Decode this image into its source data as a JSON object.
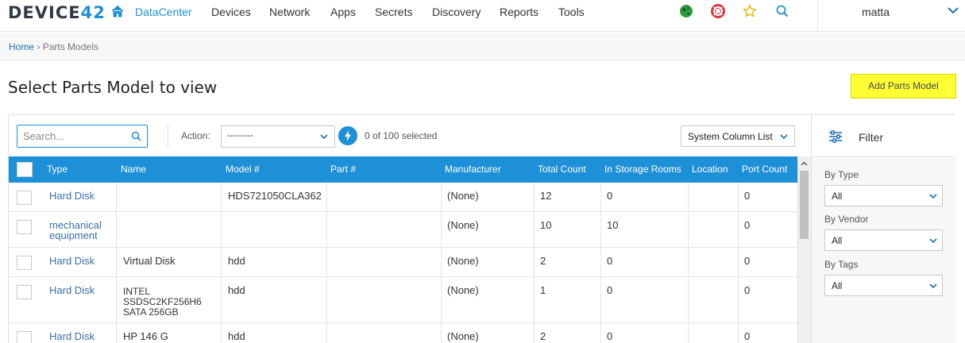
{
  "nav": {
    "logo_prefix": "DEVICE",
    "logo_suffix": "42",
    "items": [
      "DataCenter",
      "Devices",
      "Network",
      "Apps",
      "Secrets",
      "Discovery",
      "Reports",
      "Tools"
    ],
    "user": "matta",
    "icons": [
      "home-icon",
      "globe-icon",
      "help-lifebuoy-icon",
      "star-icon",
      "search-icon",
      "chevron-down-icon"
    ],
    "accent": "#1e90d8"
  },
  "breadcrumb": {
    "home": "Home",
    "separator": "›",
    "current": "Parts Models"
  },
  "page": {
    "title": "Select Parts Model to view",
    "add_button": "Add Parts Model",
    "add_button_color": "#ffff33"
  },
  "toolbar": {
    "search_placeholder": "Search...",
    "action_label": "Action:",
    "action_value": "---------",
    "selected_count": "0 of 100 selected",
    "column_list": "System Column List"
  },
  "table": {
    "header_color": "#1e90d8",
    "columns": [
      "Type",
      "Name",
      "Model #",
      "Part #",
      "Manufacturer",
      "Total Count",
      "In Storage Rooms",
      "Location",
      "Port Count"
    ],
    "rows": [
      {
        "type": [
          "Hard Disk"
        ],
        "name": [],
        "model": "HDS721050CLA362",
        "part": "",
        "manufacturer": "(None)",
        "total": "12",
        "storage": "0",
        "location": "",
        "ports": "0"
      },
      {
        "type": [
          "mechanical",
          "equipment"
        ],
        "name": [],
        "model": "",
        "part": "",
        "manufacturer": "(None)",
        "total": "10",
        "storage": "10",
        "location": "",
        "ports": "0"
      },
      {
        "type": [
          "Hard Disk"
        ],
        "name": [
          "Virtual Disk"
        ],
        "model": "hdd",
        "part": "",
        "manufacturer": "(None)",
        "total": "2",
        "storage": "0",
        "location": "",
        "ports": "0"
      },
      {
        "type": [
          "Hard Disk"
        ],
        "name": [
          "INTEL",
          "SSDSC2KF256H6",
          "SATA 256GB"
        ],
        "model": "hdd",
        "part": "",
        "manufacturer": "(None)",
        "total": "1",
        "storage": "0",
        "location": "",
        "ports": "0"
      },
      {
        "type": [
          "Hard Disk"
        ],
        "name": [
          "HP 146 G"
        ],
        "model": "hdd",
        "part": "",
        "manufacturer": "(None)",
        "total": "2",
        "storage": "0",
        "location": "",
        "ports": "0"
      }
    ]
  },
  "filter": {
    "title": "Filter",
    "groups": [
      {
        "label": "By Type",
        "value": "All"
      },
      {
        "label": "By Vendor",
        "value": "All"
      },
      {
        "label": "By Tags",
        "value": "All"
      }
    ]
  }
}
